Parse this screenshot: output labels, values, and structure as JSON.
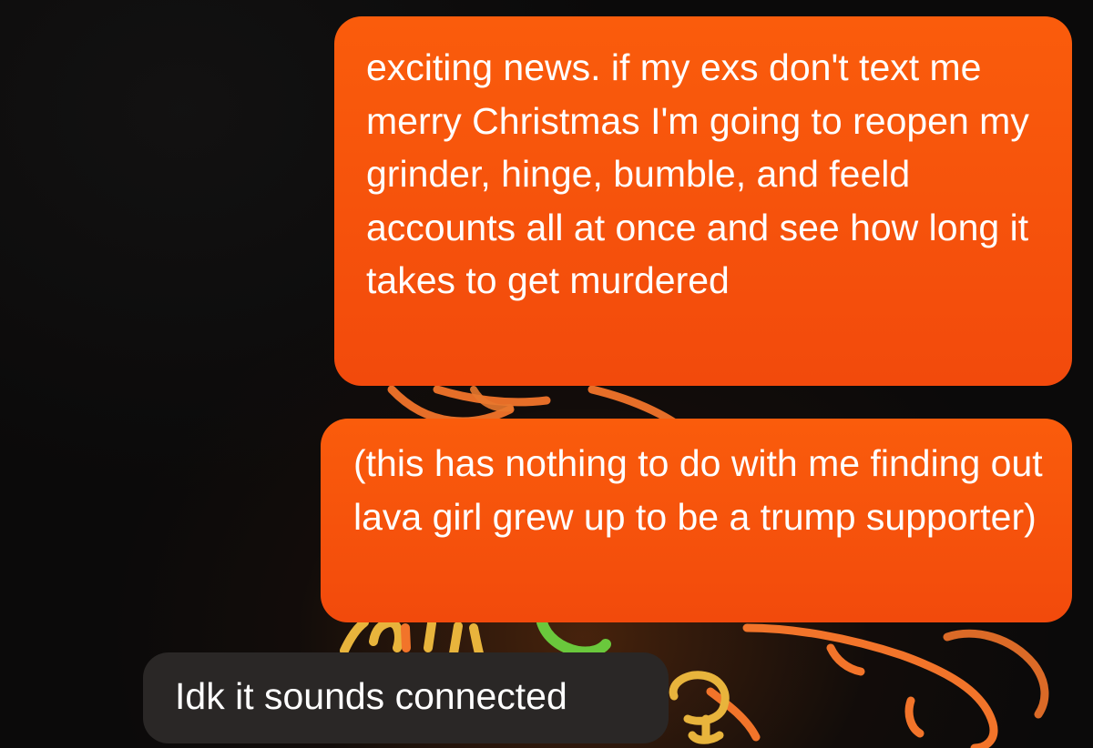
{
  "chat": {
    "messages": [
      {
        "direction": "outgoing",
        "text": "exciting news. if my exs don't text me merry Christmas I'm going to reopen my grinder, hinge, bumble, and feeld accounts all at once and see how long it takes to get murdered"
      },
      {
        "direction": "outgoing",
        "text": "(this has nothing to do with me finding out lava girl grew up to be a trump supporter)"
      },
      {
        "direction": "incoming",
        "text": "Idk it sounds connected"
      }
    ],
    "colors": {
      "outgoing_bubble": "#f7520c",
      "incoming_bubble": "#2a2726",
      "background": "#0b0a0a",
      "wallpaper_orange": "#f2742a",
      "wallpaper_yellow": "#e8b43c",
      "wallpaper_green": "#6ac83c"
    },
    "wallpaper": "neon-line-food-doodle"
  }
}
